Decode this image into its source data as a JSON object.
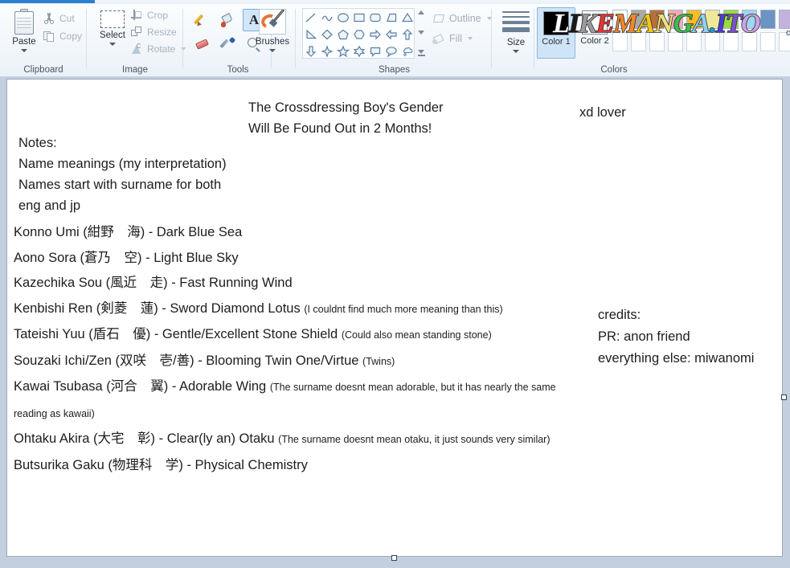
{
  "app": {
    "name": "Paint"
  },
  "ribbon": {
    "groups": [
      {
        "name": "Clipboard",
        "label": "Clipboard"
      },
      {
        "name": "Image",
        "label": "Image"
      },
      {
        "name": "Tools",
        "label": "Tools"
      },
      {
        "name": "Shapes",
        "label": "Shapes"
      },
      {
        "name": "Colors",
        "label": "Colors"
      }
    ],
    "clipboard": {
      "paste_label": "Paste",
      "cut_label": "Cut",
      "copy_label": "Copy"
    },
    "image": {
      "select_label": "Select",
      "crop_label": "Crop",
      "resize_label": "Resize",
      "rotate_label": "Rotate"
    },
    "tools": {
      "items": [
        {
          "name": "pencil-tool",
          "selected": false
        },
        {
          "name": "fill-with-color-tool",
          "selected": false
        },
        {
          "name": "text-tool",
          "glyph": "A",
          "selected": true
        },
        {
          "name": "eraser-tool",
          "selected": false
        },
        {
          "name": "color-picker-tool",
          "selected": false
        },
        {
          "name": "magnifier-tool",
          "selected": false
        }
      ]
    },
    "brushes": {
      "label": "Brushes"
    },
    "shapes": {
      "items": [
        "line",
        "curve",
        "oval",
        "rectangle",
        "rounded-rectangle",
        "polygon",
        "triangle",
        "right-triangle",
        "diamond",
        "pentagon",
        "hexagon",
        "right-arrow",
        "left-arrow",
        "up-arrow",
        "down-arrow",
        "four-point-star",
        "five-point-star",
        "six-point-star",
        "rounded-rectangular-callout",
        "oval-callout",
        "cloud-callout"
      ],
      "outline_label": "Outline",
      "fill_label": "Fill"
    },
    "size": {
      "label": "Size"
    },
    "colors": {
      "color1_label": "Color\n1",
      "color1_value": "#000000",
      "color2_label": "Color\n2",
      "color2_value": "#ffffff",
      "edit_colors_label": "c",
      "row1": [
        "#ffffff",
        "#a8a8a8",
        "#b5703c",
        "#f4a7bb",
        "#f6bd2a",
        "#efe79a",
        "#9ada3e",
        "#9fd7ef",
        "#6b93c4",
        "#c3b2dd"
      ],
      "row2": [
        "",
        "",
        "",
        "",
        "",
        "",
        "",
        "",
        "",
        ""
      ]
    }
  },
  "watermark": {
    "letters": [
      {
        "ch": "L",
        "color": "#ffffff"
      },
      {
        "ch": "I",
        "color": "#1a1a1a"
      },
      {
        "ch": "K",
        "color": "#9b9b9b"
      },
      {
        "ch": "E",
        "color": "#e03535"
      },
      {
        "ch": "M",
        "color": "#f0882a"
      },
      {
        "ch": "A",
        "color": "#f5c518"
      },
      {
        "ch": "N",
        "color": "#ece27c"
      },
      {
        "ch": "G",
        "color": "#3bbf4a"
      },
      {
        "ch": "A",
        "color": "#8ed0ef"
      },
      {
        "ch": ".",
        "color": "#1a9ee0"
      },
      {
        "ch": "I",
        "color": "#4a3fcf"
      },
      {
        "ch": "T",
        "color": "#7b4fd0"
      },
      {
        "ch": "O",
        "color": "#c9a4e8"
      }
    ]
  },
  "canvas": {
    "title": "The Crossdressing Boy's Gender\nWill Be Found Out in 2 Months!",
    "xd_lover": "xd lover",
    "notes": "Notes:\nName meanings (my interpretation)\nNames start with surname for both\neng and jp",
    "credits": "credits:\nPR: anon friend\neverything else: miwanomi",
    "names": [
      {
        "main": "Konno Umi (紺野　海) - Dark Blue Sea",
        "note": ""
      },
      {
        "main": "Aono Sora (蒼乃　空) - Light Blue Sky",
        "note": ""
      },
      {
        "main": "Kazechika Sou (風近　走) - Fast Running Wind",
        "note": ""
      },
      {
        "main": "Kenbishi Ren (剣菱　蓮) - Sword Diamond Lotus ",
        "note": "(I couldnt find much more meaning than this)"
      },
      {
        "main": "Tateishi Yuu (盾石　優) - Gentle/Excellent Stone Shield ",
        "note": "(Could also mean standing stone)"
      },
      {
        "main": "Souzaki Ichi/Zen (双咲　壱/善) - Blooming Twin One/Virtue ",
        "note": "(Twins)"
      },
      {
        "main": "Kawai Tsubasa (河合　翼) - Adorable Wing ",
        "note": "(The surname doesnt mean adorable, but it has nearly the same reading as kawaii)"
      },
      {
        "main": "Ohtaku Akira (大宅　彰) - Clear(ly an) Otaku ",
        "note": "(The surname doesnt mean otaku, it just sounds very similar)"
      },
      {
        "main": "Butsurika Gaku (物理科　学) - Physical Chemistry",
        "note": ""
      }
    ]
  }
}
